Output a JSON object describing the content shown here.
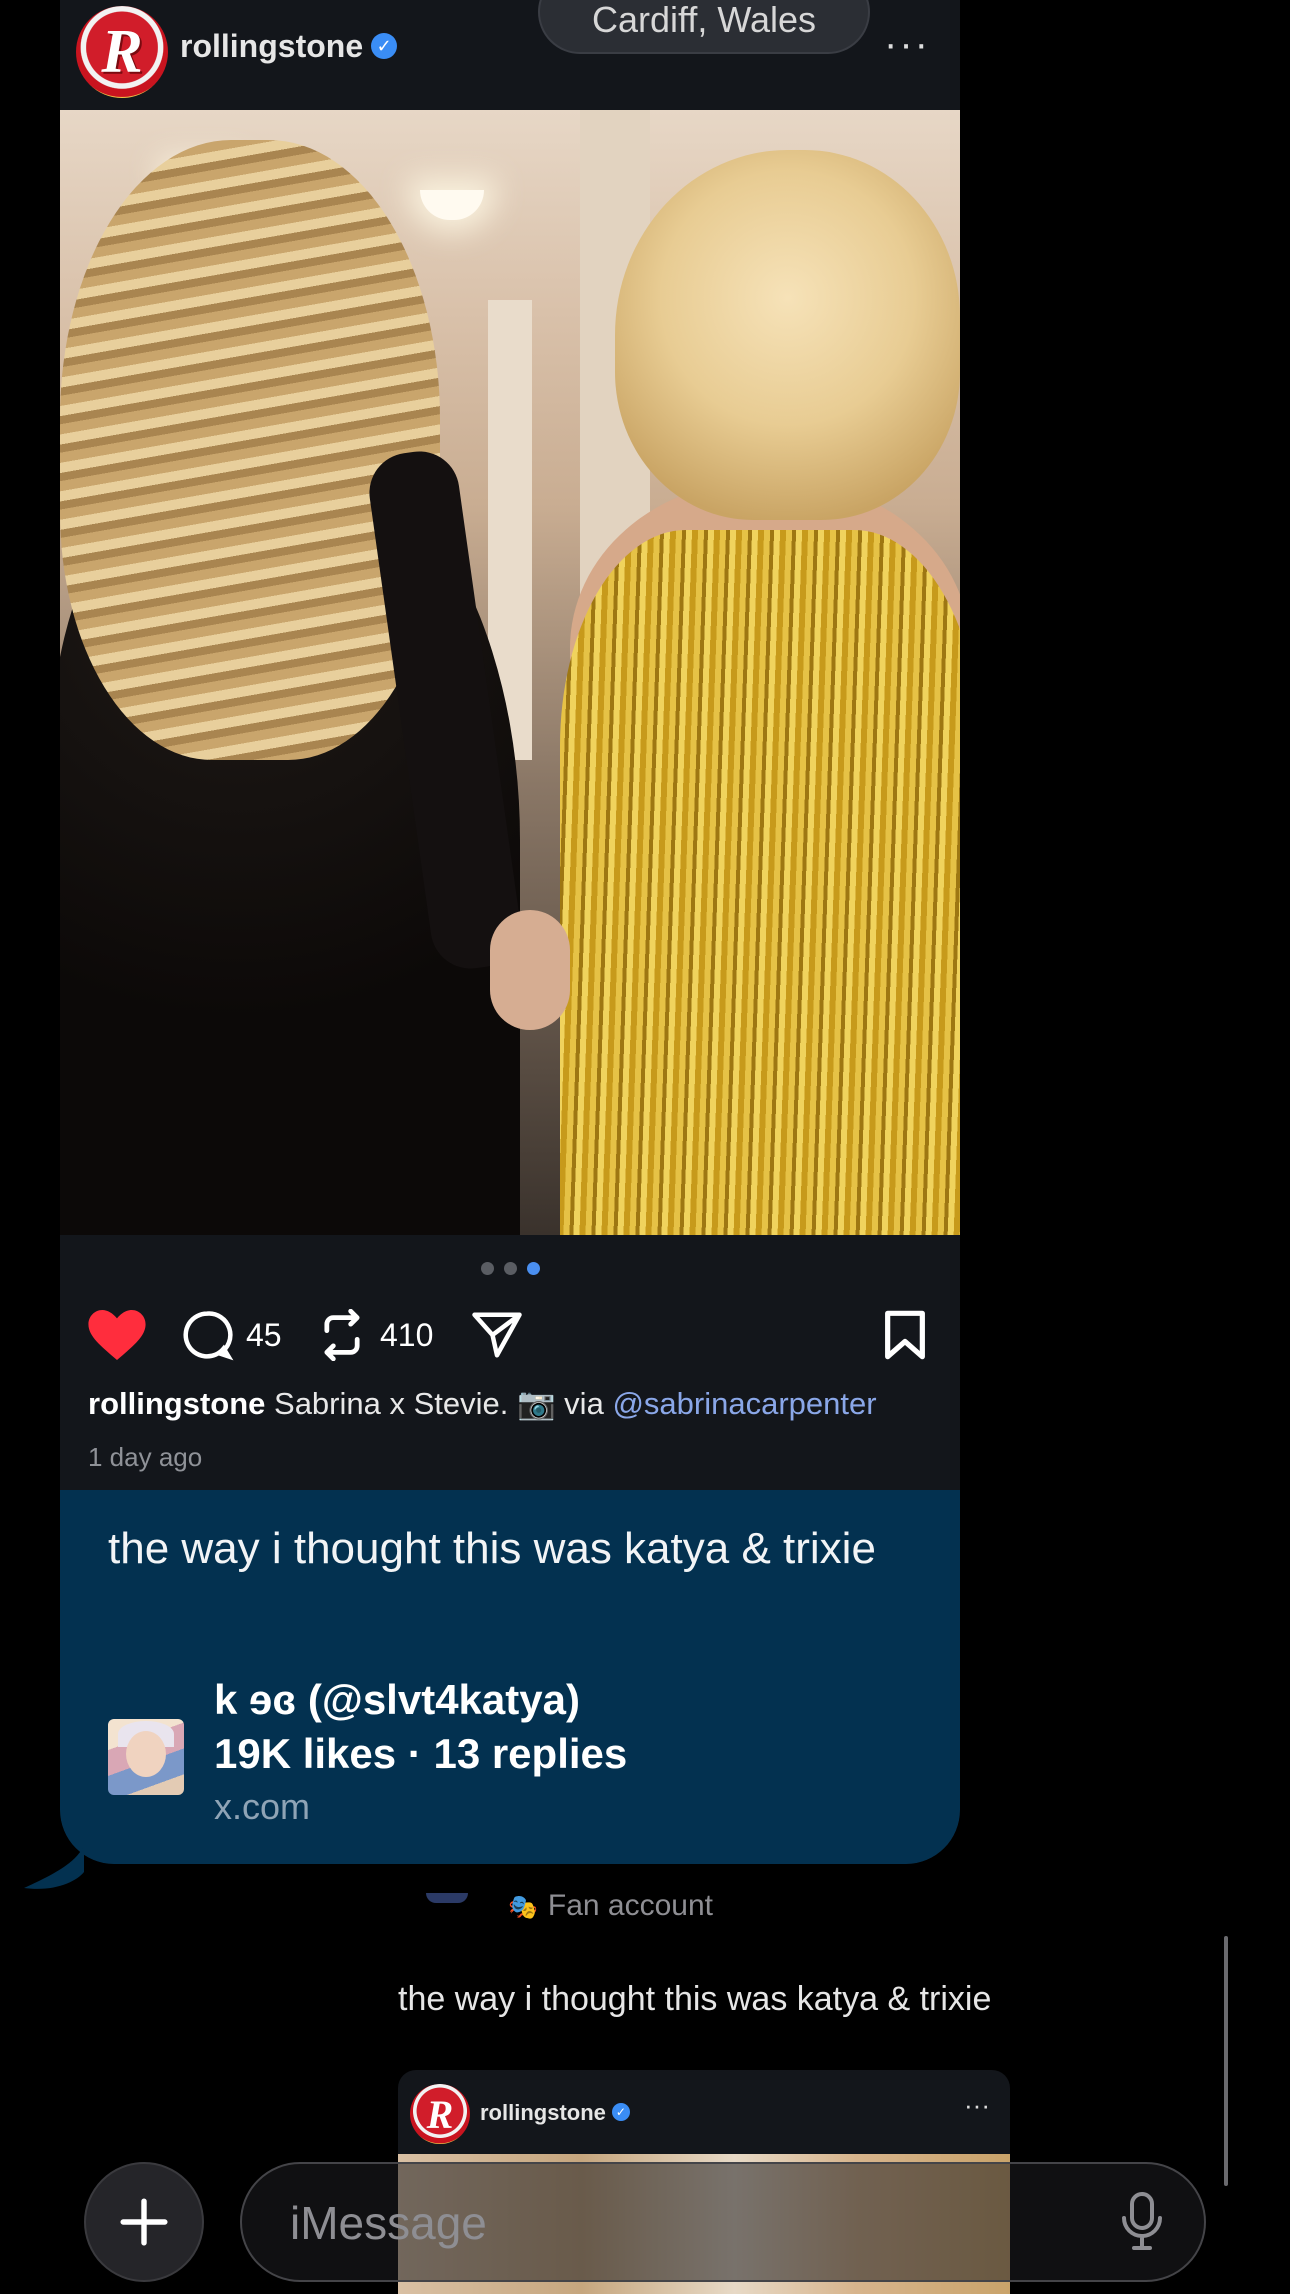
{
  "post": {
    "handle": "rollingstone",
    "location": "Cardiff, Wales",
    "carousel": {
      "count": 3,
      "active": 3
    },
    "actions": {
      "comments": "45",
      "reposts": "410"
    },
    "caption_user": "rollingstone",
    "caption_text": "Sabrina x Stevie. 📷 via",
    "caption_mention": "@sabrinacarpenter",
    "time": "1 day ago"
  },
  "message": {
    "text": "the way i thought this was katya & trixie",
    "link_title": "k ɘɞ (@slvt4katya)",
    "link_stats": "19K likes · 13 replies",
    "link_domain": "x.com"
  },
  "thread": {
    "fan_label": "Fan account",
    "quoted_text": "the way i thought this was katya & trixie",
    "mini_handle": "rollingstone"
  },
  "composer": {
    "placeholder": "iMessage"
  },
  "colors": {
    "bubble": "#033150",
    "card": "#13161b",
    "accent": "#4a8ff0",
    "like": "#ff2d3d"
  }
}
